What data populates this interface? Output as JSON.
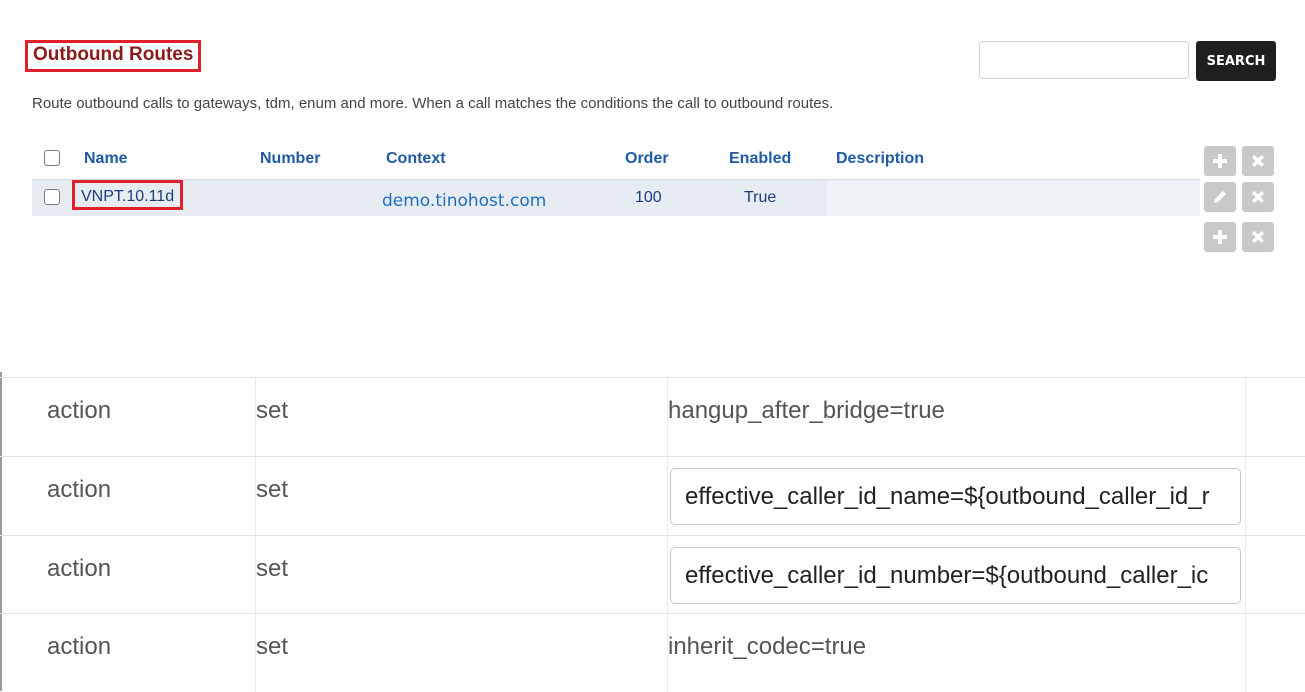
{
  "header": {
    "title": "Outbound Routes",
    "description": "Route outbound calls to gateways, tdm, enum and more. When a call matches the conditions the call to outbound routes."
  },
  "search": {
    "placeholder": "",
    "value": "",
    "button_label": "SEARCH"
  },
  "table": {
    "columns": [
      "Name",
      "Number",
      "Context",
      "Order",
      "Enabled",
      "Description"
    ],
    "rows": [
      {
        "name": "VNPT.10.11d",
        "number": "",
        "context": "demo.tinohost.com",
        "order": "100",
        "enabled": "True",
        "description": ""
      }
    ]
  },
  "icons": {
    "add": "plus-icon",
    "delete": "x-icon",
    "edit": "pencil-icon"
  },
  "colors": {
    "title": "#8b1a1a",
    "highlight_border": "#e0202a",
    "header_text": "#1f5aa6",
    "row_bg": "#e7ebf2",
    "button_bg": "#1f1f1f",
    "icon_button_bg": "#c9c9c9"
  },
  "details": {
    "rows": [
      {
        "tag": "action",
        "type": "set",
        "data": "hangup_after_bridge=true",
        "editable": false
      },
      {
        "tag": "action",
        "type": "set",
        "data": "effective_caller_id_name=${outbound_caller_id_r",
        "editable": true
      },
      {
        "tag": "action",
        "type": "set",
        "data": "effective_caller_id_number=${outbound_caller_ic",
        "editable": true
      },
      {
        "tag": "action",
        "type": "set",
        "data": "inherit_codec=true",
        "editable": false
      }
    ]
  }
}
